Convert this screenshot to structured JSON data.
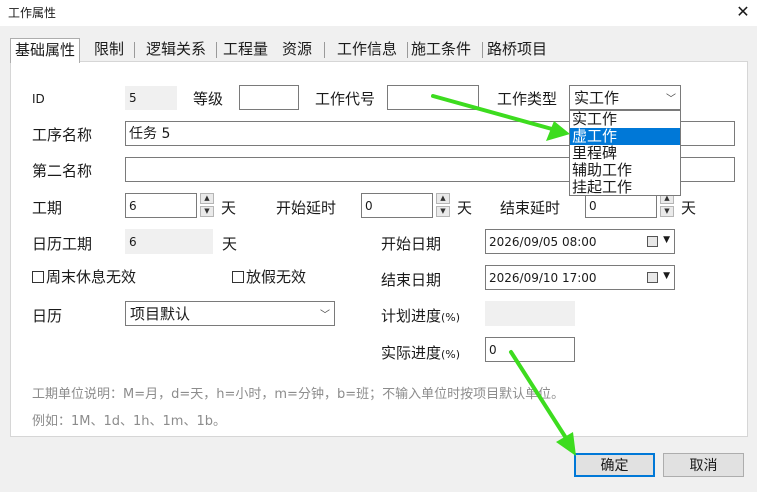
{
  "window": {
    "title": "工作属性",
    "close": "✕"
  },
  "tabs": [
    {
      "label": "基础属性"
    },
    {
      "label": "限制"
    },
    {
      "label": "逻辑关系"
    },
    {
      "label": "工程量"
    },
    {
      "label": "资源"
    },
    {
      "label": "工作信息"
    },
    {
      "label": "施工条件"
    },
    {
      "label": "路桥项目"
    }
  ],
  "form": {
    "id_label": "ID",
    "id_value": "5",
    "grade_label": "等级",
    "grade_value": "",
    "code_label": "工作代号",
    "code_value": "",
    "type_label": "工作类型",
    "type_value": "实工作",
    "type_options": [
      "实工作",
      "虚工作",
      "里程碑",
      "辅助工作",
      "挂起工作"
    ],
    "type_highlighted": "虚工作",
    "name_label": "工序名称",
    "name_value": "任务 5",
    "second_name_label": "第二名称",
    "second_name_value": "",
    "duration_label": "工期",
    "duration_value": "6",
    "duration_unit": "天",
    "start_delay_label": "开始延时",
    "start_delay_value": "0",
    "start_delay_unit": "天",
    "end_delay_label": "结束延时",
    "end_delay_value": "0",
    "end_delay_unit": "天",
    "calendar_duration_label": "日历工期",
    "calendar_duration_value": "6",
    "calendar_duration_unit": "天",
    "start_date_label": "开始日期",
    "start_date_value": "2026/09/05 08:00",
    "weekend_label": "周末休息无效",
    "holiday_label": "放假无效",
    "end_date_label": "结束日期",
    "end_date_value": "2026/09/10 17:00",
    "calendar_label": "日历",
    "calendar_value": "项目默认",
    "plan_progress_label": "计划进度",
    "plan_progress_unit": "(%)",
    "plan_progress_value": "",
    "actual_progress_label": "实际进度",
    "actual_progress_unit": "(%)",
    "actual_progress_value": "0"
  },
  "help": {
    "line1": "工期单位说明：M=月，d=天，h=小时，m=分钟，b=班；不输入单位时按项目默认单位。",
    "line2": "例如：1M、1d、1h、1m、1b。"
  },
  "buttons": {
    "ok": "确定",
    "cancel": "取消"
  },
  "colors": {
    "accent": "#0078d7",
    "annotation_arrow": "#3ddc1f"
  }
}
